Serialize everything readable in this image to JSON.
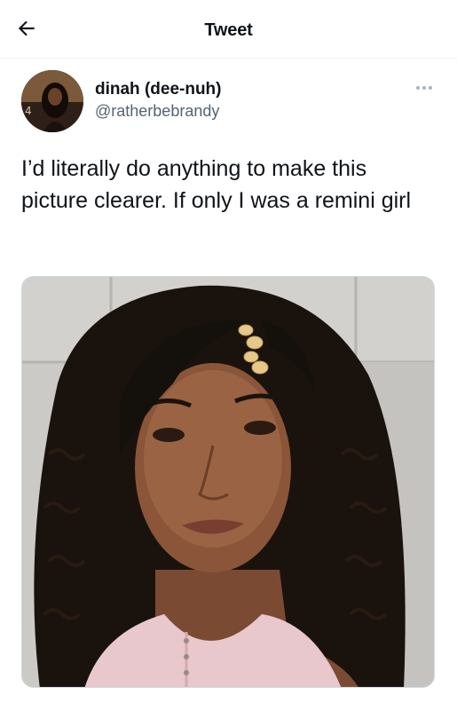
{
  "header": {
    "title": "Tweet",
    "back_icon": "arrow-left-icon"
  },
  "tweet": {
    "author": {
      "name": "dinah (dee-nuh)",
      "handle": "@ratherbebrandy",
      "avatar_icon": "avatar-photo"
    },
    "more_icon": "more-horizontal-icon",
    "text": "I’d literally do anything to make this picture clearer. If only I was a remini girl",
    "media": {
      "type": "photo",
      "description_icon": "portrait-photo"
    }
  },
  "colors": {
    "text_primary": "#0f1419",
    "text_secondary": "#536471",
    "border": "#cfd9de",
    "background": "#ffffff"
  }
}
